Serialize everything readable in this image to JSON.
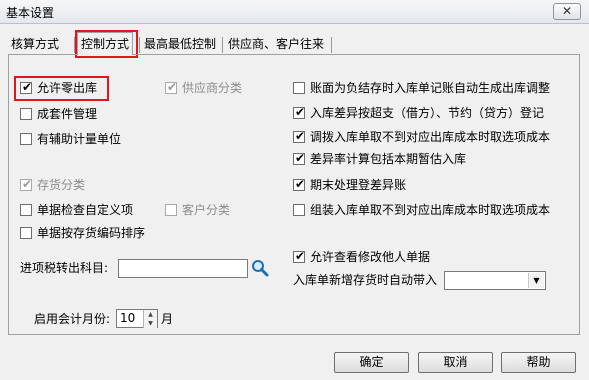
{
  "window": {
    "title": "基本设置",
    "close": "✕"
  },
  "tabs": [
    "核算方式",
    "控制方式",
    "最高最低控制",
    "供应商、客户往来"
  ],
  "left_options": [
    {
      "label": "允许零出库",
      "checked": true,
      "enabled": true
    },
    {
      "label": "成套件管理",
      "checked": false,
      "enabled": true
    },
    {
      "label": "有辅助计量单位",
      "checked": false,
      "enabled": true
    },
    {
      "label": "存货分类",
      "checked": true,
      "enabled": false
    },
    {
      "label": "单据检查自定义项",
      "checked": false,
      "enabled": true
    },
    {
      "label": "单据按存货编码排序",
      "checked": false,
      "enabled": true
    }
  ],
  "mid_options": [
    {
      "label": "供应商分类",
      "checked": true,
      "enabled": false
    },
    {
      "label": "客户分类",
      "checked": false,
      "enabled": false
    }
  ],
  "right_options": [
    {
      "label": "账面为负结存时入库单记账自动生成出库调整",
      "checked": false,
      "enabled": true
    },
    {
      "label": "入库差异按超支（借方）、节约（贷方）登记",
      "checked": true,
      "enabled": true
    },
    {
      "label": "调拨入库单取不到对应出库成本时取选项成本",
      "checked": true,
      "enabled": true
    },
    {
      "label": "差异率计算包括本期暂估入库",
      "checked": true,
      "enabled": true
    },
    {
      "label": "期末处理登差异账",
      "checked": true,
      "enabled": true
    },
    {
      "label": "组装入库单取不到对应出库成本时取选项成本",
      "checked": false,
      "enabled": true
    },
    {
      "label": "允许查看修改他人单据",
      "checked": true,
      "enabled": true
    }
  ],
  "tax_account": {
    "label": "进项税转出科目:",
    "value": ""
  },
  "auto_bring_in": {
    "label": "入库单新增存货时自动带入",
    "value": ""
  },
  "start_month": {
    "label": "启用会计月份:",
    "value": "10",
    "unit": "月"
  },
  "buttons": {
    "ok": "确定",
    "cancel": "取消",
    "help": "帮助"
  },
  "check_mark": "✔",
  "colors": {
    "highlight": "#e0161f"
  }
}
